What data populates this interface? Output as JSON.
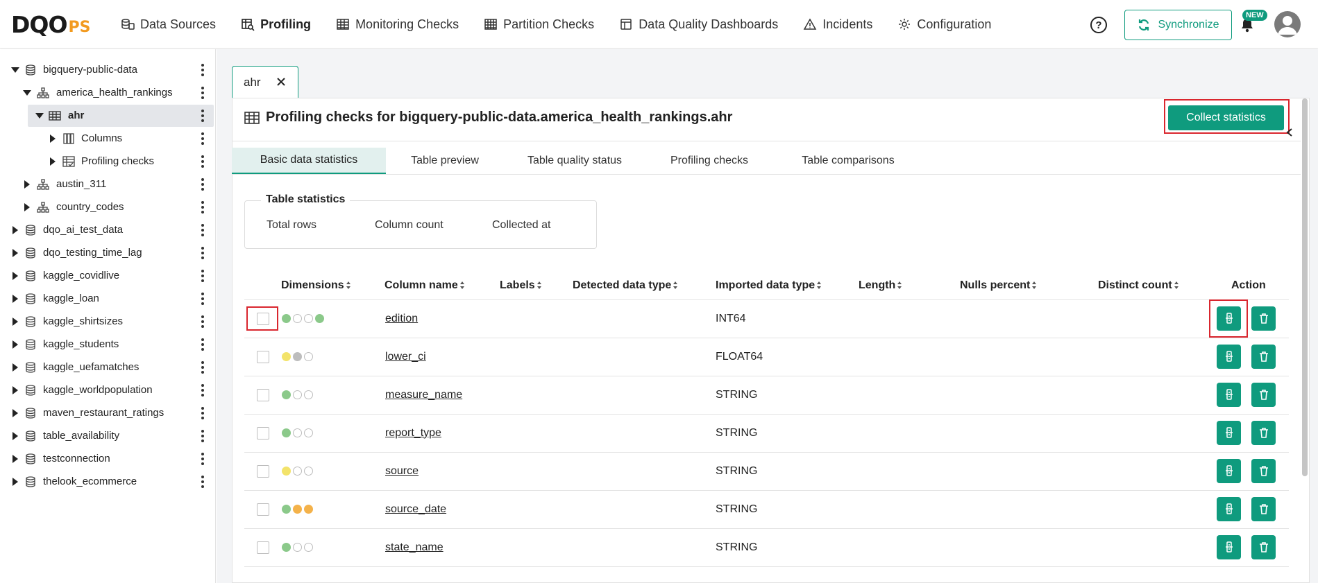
{
  "header": {
    "logo_main": "DQO",
    "logo_suffix": "PS",
    "nav": [
      {
        "label": "Data Sources",
        "icon": "data-sources-icon"
      },
      {
        "label": "Profiling",
        "icon": "profiling-icon",
        "active": true
      },
      {
        "label": "Monitoring Checks",
        "icon": "monitoring-icon"
      },
      {
        "label": "Partition Checks",
        "icon": "partition-icon"
      },
      {
        "label": "Data Quality Dashboards",
        "icon": "dashboard-icon"
      },
      {
        "label": "Incidents",
        "icon": "warning-icon"
      },
      {
        "label": "Configuration",
        "icon": "gear-icon"
      }
    ],
    "help": "?",
    "synchronize": "Synchronize",
    "new_badge": "NEW"
  },
  "sidebar": {
    "items": [
      {
        "label": "bigquery-public-data",
        "level": 0,
        "expanded": true,
        "icon": "database-icon"
      },
      {
        "label": "america_health_rankings",
        "level": 1,
        "expanded": true,
        "icon": "schema-icon"
      },
      {
        "label": "ahr",
        "level": 2,
        "expanded": true,
        "icon": "table-icon",
        "selected": true
      },
      {
        "label": "Columns",
        "level": 3,
        "expanded": false,
        "icon": "columns-icon"
      },
      {
        "label": "Profiling checks",
        "level": 3,
        "expanded": false,
        "icon": "checks-icon"
      },
      {
        "label": "austin_311",
        "level": 1,
        "expanded": false,
        "icon": "schema-icon"
      },
      {
        "label": "country_codes",
        "level": 1,
        "expanded": false,
        "icon": "schema-icon"
      },
      {
        "label": "dqo_ai_test_data",
        "level": 0,
        "expanded": false,
        "icon": "database-icon"
      },
      {
        "label": "dqo_testing_time_lag",
        "level": 0,
        "expanded": false,
        "icon": "database-icon"
      },
      {
        "label": "kaggle_covidlive",
        "level": 0,
        "expanded": false,
        "icon": "database-icon"
      },
      {
        "label": "kaggle_loan",
        "level": 0,
        "expanded": false,
        "icon": "database-icon"
      },
      {
        "label": "kaggle_shirtsizes",
        "level": 0,
        "expanded": false,
        "icon": "database-icon"
      },
      {
        "label": "kaggle_students",
        "level": 0,
        "expanded": false,
        "icon": "database-icon"
      },
      {
        "label": "kaggle_uefamatches",
        "level": 0,
        "expanded": false,
        "icon": "database-icon"
      },
      {
        "label": "kaggle_worldpopulation",
        "level": 0,
        "expanded": false,
        "icon": "database-icon"
      },
      {
        "label": "maven_restaurant_ratings",
        "level": 0,
        "expanded": false,
        "icon": "database-icon"
      },
      {
        "label": "table_availability",
        "level": 0,
        "expanded": false,
        "icon": "database-icon"
      },
      {
        "label": "testconnection",
        "level": 0,
        "expanded": false,
        "icon": "database-icon"
      },
      {
        "label": "thelook_ecommerce",
        "level": 0,
        "expanded": false,
        "icon": "database-icon"
      }
    ]
  },
  "main": {
    "open_tab": "ahr",
    "title": "Profiling checks for bigquery-public-data.america_health_rankings.ahr",
    "collect_button": "Collect statistics",
    "subtabs": [
      "Basic data statistics",
      "Table preview",
      "Table quality status",
      "Profiling checks",
      "Table comparisons"
    ],
    "active_subtab": 0,
    "table_stats": {
      "legend": "Table statistics",
      "labels": [
        "Total rows",
        "Column count",
        "Collected at"
      ]
    },
    "columns_header": [
      "Dimensions",
      "Column name",
      "Labels",
      "Detected data type",
      "Imported data type",
      "Length",
      "Nulls percent",
      "Distinct count",
      "Action"
    ],
    "rows": [
      {
        "name": "edition",
        "imported_type": "INT64",
        "dims": [
          "#8bc98a",
          "#ffffff",
          "#ffffff",
          "#8bc98a"
        ]
      },
      {
        "name": "lower_ci",
        "imported_type": "FLOAT64",
        "dims": [
          "#f3e36a",
          "#bdbdbd",
          "#ffffff"
        ]
      },
      {
        "name": "measure_name",
        "imported_type": "STRING",
        "dims": [
          "#8bc98a",
          "#ffffff",
          "#ffffff"
        ]
      },
      {
        "name": "report_type",
        "imported_type": "STRING",
        "dims": [
          "#8bc98a",
          "#ffffff",
          "#ffffff"
        ]
      },
      {
        "name": "source",
        "imported_type": "STRING",
        "dims": [
          "#f3e36a",
          "#ffffff",
          "#ffffff"
        ]
      },
      {
        "name": "source_date",
        "imported_type": "STRING",
        "dims": [
          "#8bc98a",
          "#f4b24a",
          "#f4b24a"
        ]
      },
      {
        "name": "state_name",
        "imported_type": "STRING",
        "dims": [
          "#8bc98a",
          "#ffffff",
          "#ffffff"
        ]
      }
    ]
  },
  "colors": {
    "accent": "#0f9b7e",
    "highlight": "#d9262e"
  }
}
